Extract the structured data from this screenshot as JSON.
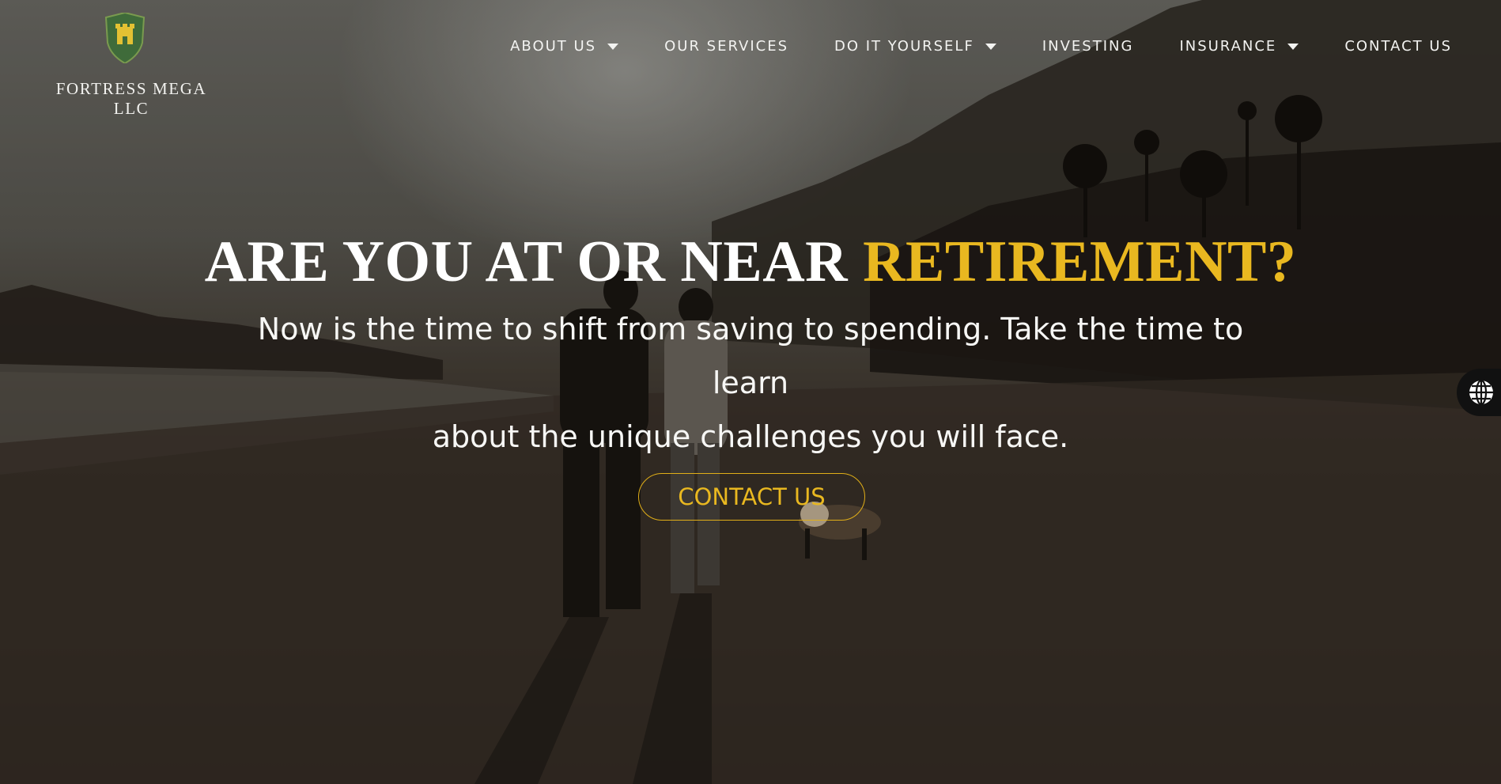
{
  "site": {
    "brand_name": "FORTRESS MEGA LLC",
    "logo_icon": "fortress-shield-icon"
  },
  "nav": {
    "items": [
      {
        "label": "ABOUT US",
        "has_dropdown": true
      },
      {
        "label": "OUR SERVICES",
        "has_dropdown": false
      },
      {
        "label": "DO IT YOURSELF",
        "has_dropdown": true
      },
      {
        "label": "INVESTING",
        "has_dropdown": false
      },
      {
        "label": "INSURANCE",
        "has_dropdown": true
      },
      {
        "label": "CONTACT US",
        "has_dropdown": false
      }
    ]
  },
  "hero": {
    "headline_main": "ARE YOU AT OR NEAR ",
    "headline_accent": "RETIREMENT?",
    "subtext_line1": "Now is the time to shift from saving to spending. Take the time to learn",
    "subtext_line2": "about the unique challenges you will face.",
    "cta_label": "CONTACT US"
  },
  "language_widget": {
    "icon": "globe-icon"
  },
  "colors": {
    "accent": "#e9b820",
    "text": "#ffffff"
  }
}
